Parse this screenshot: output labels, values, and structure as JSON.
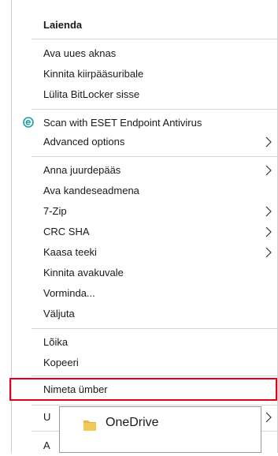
{
  "context_menu": {
    "items": [
      {
        "label": "Laienda",
        "bold": true
      },
      {
        "label": "Ava uues aknas"
      },
      {
        "label": "Kinnita kiirpääsuribale"
      },
      {
        "label": "Lülita BitLocker sisse"
      },
      {
        "label": "Scan with ESET Endpoint Antivirus",
        "icon": "eset-icon"
      },
      {
        "label": "Advanced options",
        "submenu": true
      },
      {
        "label": "Anna juurdepääs",
        "submenu": true
      },
      {
        "label": "Ava kandeseadmena"
      },
      {
        "label": "7-Zip",
        "submenu": true
      },
      {
        "label": "CRC SHA",
        "submenu": true
      },
      {
        "label": "Kaasa teeki",
        "submenu": true
      },
      {
        "label": "Kinnita avakuvale"
      },
      {
        "label": "Vorminda..."
      },
      {
        "label": "Väljuta"
      },
      {
        "label": "Lõika"
      },
      {
        "label": "Kopeeri"
      },
      {
        "label": "Nimeta ümber",
        "highlighted": true
      },
      {
        "label": "U",
        "submenu": true,
        "partially_hidden": true
      },
      {
        "label": "A",
        "partially_hidden": true
      }
    ]
  },
  "drag_tooltip": {
    "label": "OneDrive",
    "icon": "folder-icon"
  },
  "colors": {
    "highlight_border": "#e3001b",
    "eset_icon": "#1ba1a1",
    "folder": "#e8b64a"
  }
}
